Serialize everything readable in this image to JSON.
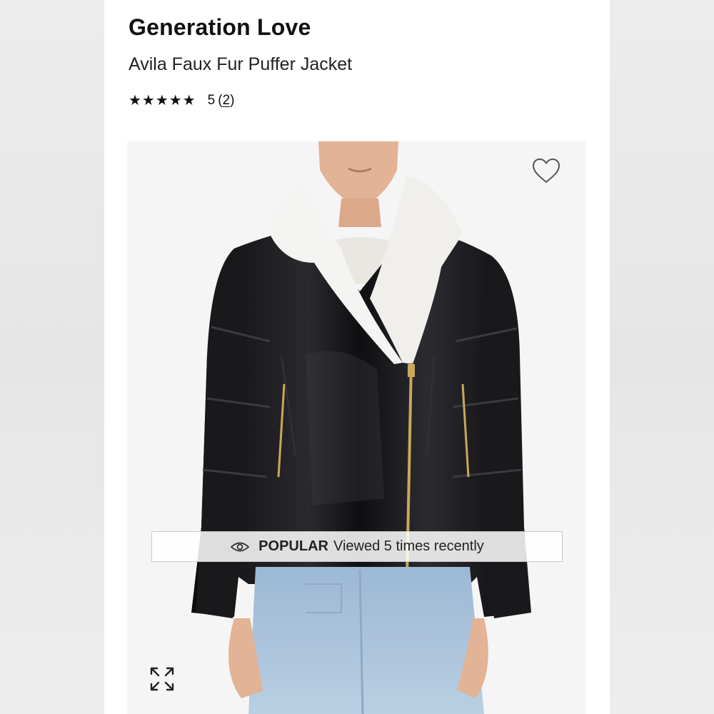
{
  "product": {
    "brand": "Generation Love",
    "name": "Avila Faux Fur Puffer Jacket",
    "rating_stars": "★★★★★",
    "rating_value": "5",
    "rating_count_open": "(",
    "rating_count": "2",
    "rating_count_close": ")",
    "rating_stars_filled": 5,
    "rating_stars_max": 5
  },
  "gallery": {
    "favorite_icon": "heart-outline-icon",
    "expand_icon": "expand-arrows-icon",
    "badge": {
      "icon": "eye-icon",
      "label": "POPULAR",
      "text": "Viewed 5 times recently"
    }
  },
  "colors": {
    "jacket": "#141416",
    "collar": "#f4f4f2",
    "denim": "#a9c3dc",
    "skin": "#e2b394"
  }
}
